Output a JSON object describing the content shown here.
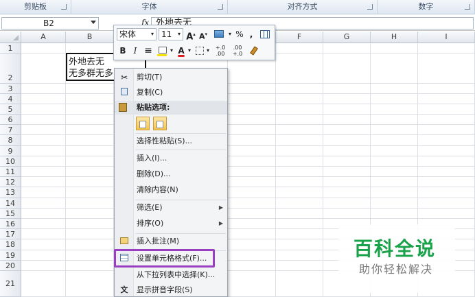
{
  "ribbon": {
    "groups": [
      {
        "label": "剪贴板"
      },
      {
        "label": "字体"
      },
      {
        "label": "对齐方式"
      },
      {
        "label": "数字"
      }
    ]
  },
  "formula_bar": {
    "name_box": "B2",
    "fx": "fx",
    "content": "外地去无"
  },
  "grid": {
    "columns": [
      "A",
      "B",
      "",
      "",
      "",
      "F",
      "G",
      "H",
      "I"
    ],
    "rows": [
      "1",
      "2",
      "3",
      "4",
      "5",
      "6",
      "7",
      "8",
      "9",
      "10",
      "11",
      "12",
      "13",
      "14",
      "15",
      "16",
      "17",
      "18",
      "19",
      "20",
      "21"
    ],
    "active_cell": {
      "line1": "外地去无",
      "line2": "无多群无多"
    }
  },
  "mini_toolbar": {
    "font_name": "宋体",
    "font_size": "11",
    "grow_font": "A",
    "shrink_font": "A",
    "percent": "%",
    "comma": ",",
    "bold": "B",
    "italic": "I",
    "font_color": "A",
    "inc_decimal": "+.0 .00",
    "dec_decimal": ".00 +.0"
  },
  "context_menu": {
    "items": [
      {
        "label": "剪切(T)",
        "icon": "scissors-icon"
      },
      {
        "label": "复制(C)",
        "icon": "copy-icon"
      },
      {
        "label": "粘贴选项:",
        "icon": "paste-icon"
      },
      {
        "label": "选择性粘贴(S)..."
      },
      {
        "label": "插入(I)..."
      },
      {
        "label": "删除(D)..."
      },
      {
        "label": "清除内容(N)"
      },
      {
        "label": "筛选(E)",
        "submenu": true
      },
      {
        "label": "排序(O)",
        "submenu": true
      },
      {
        "label": "插入批注(M)",
        "icon": "comment-icon"
      },
      {
        "label": "设置单元格格式(F)...",
        "icon": "format-cells-icon"
      },
      {
        "label": "从下拉列表中选择(K)..."
      },
      {
        "label": "显示拼音字段(S)",
        "icon": "phonetic-icon"
      }
    ]
  },
  "watermark": {
    "title": "百科全说",
    "subtitle": "助你轻松解决"
  },
  "colors": {
    "highlight": "#9b3fc2",
    "watermark_green": "#1aa24a"
  }
}
